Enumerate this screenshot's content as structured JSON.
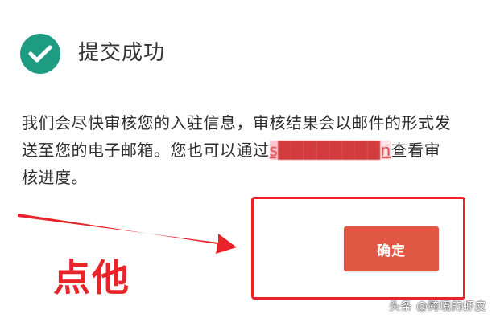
{
  "dialog": {
    "title": "提交成功",
    "message_part1": "我们会尽快审核您的入驻信息，审核结果会以邮件的形式发送至您的电子邮箱。您也可以通过",
    "message_link": "s████████n",
    "message_part2": "查看审核进度。",
    "confirm_label": "确定",
    "icon": "check-circle-icon",
    "colors": {
      "success": "#1e9c82",
      "button": "#e05744"
    }
  },
  "annotation": {
    "callout": "点他",
    "color": "#e8242a"
  },
  "watermark": {
    "text": "头条 @跨境的虾皮"
  }
}
